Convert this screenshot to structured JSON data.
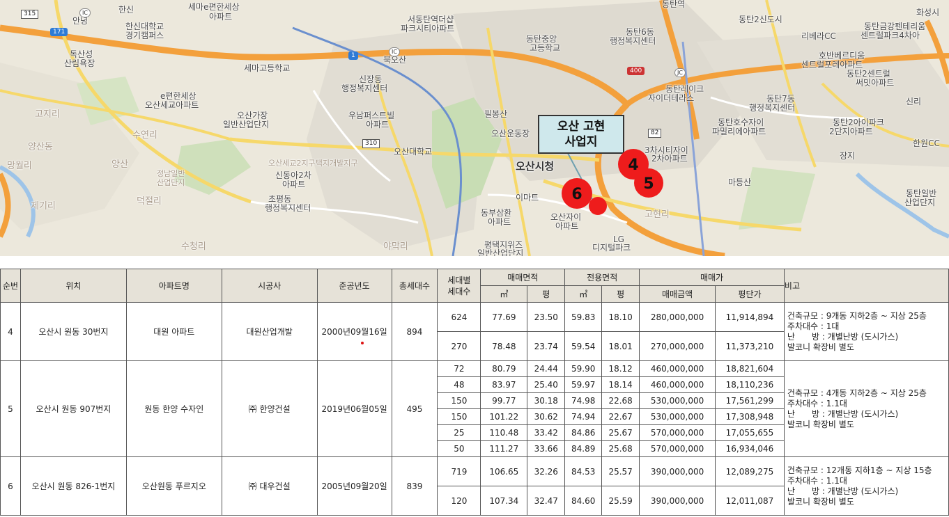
{
  "map": {
    "callout": {
      "line1": "오산 고현",
      "line2": "사업지"
    },
    "pins": [
      "4",
      "5",
      "6"
    ],
    "route_labels": [
      "315",
      "171",
      "1",
      "400",
      "310",
      "82"
    ],
    "labels": [
      "한신",
      "안녕",
      "세마e편한세상",
      "아파트",
      "한신대학교",
      "경기캠퍼스",
      "독산성",
      "산림욕장",
      "북오산",
      "세마고등학교",
      "신장동",
      "행정복지센터",
      "e편한세상",
      "오산세교아파트",
      "고지리",
      "수연리",
      "망월리",
      "양산동",
      "제기리",
      "덕절리",
      "수청리",
      "양산",
      "서동탄역더샵",
      "파크시티아파트",
      "동탄중앙",
      "고등학교",
      "동탄6동",
      "행정복지센터",
      "동탄역",
      "동탄2신도시",
      "리베라CC",
      "호반베르디움",
      "센트럴포레아파트",
      "동탄금강펜테리움",
      "센트럴파크4차아",
      "동탄2센트럴",
      "써밋아파트",
      "동탄레이크",
      "자이더테라스",
      "동탄7동",
      "행정복지센터",
      "동탄호수자이",
      "파밀리에아파트",
      "동탄2아이파크",
      "2단지아파트",
      "한원CC",
      "신리",
      "화성시",
      "오산가장",
      "일반산업단지",
      "우남퍼스트빌",
      "아파트",
      "필봉산",
      "오산대학교",
      "오산운동장",
      "오산세교2지구택지개발지구",
      "오산시청",
      "신동아2차",
      "아파트",
      "초평동",
      "행정복지센터",
      "이마트",
      "동부삼환",
      "아파트",
      "오산자이",
      "아파트",
      "정남일반",
      "산업단지",
      "3차시티자이",
      "2차아파트",
      "마등산",
      "고현리",
      "동탄일반",
      "산업단지",
      "장지",
      "야막리",
      "평택지위즈",
      "일반산업단지",
      "LG",
      "디지털파크"
    ]
  },
  "table": {
    "headers": {
      "seq": "순번",
      "location": "위치",
      "apt": "아파트명",
      "builder": "시공사",
      "completed": "준공년도",
      "households": "총세대수",
      "unit_households_1": "세대별",
      "unit_households_2": "세대수",
      "sale_area": "매매면적",
      "exclusive_area": "전용면적",
      "sale_price": "매매가",
      "note": "비고",
      "sqm": "㎡",
      "pyeong": "평",
      "sale_amount": "매매금액",
      "per_pyeong": "평단가"
    },
    "rows": [
      {
        "seq": "4",
        "location": "오산시 원동 30번지",
        "apt": "대원 아파트",
        "builder": "대원산업개발",
        "completed": "2000년09월16일",
        "households": "894",
        "units": [
          {
            "hh": "624",
            "sale_sqm": "77.69",
            "sale_py": "23.50",
            "ex_sqm": "59.83",
            "ex_py": "18.10",
            "price": "280,000,000",
            "per_py": "11,914,894"
          },
          {
            "hh": "270",
            "sale_sqm": "78.48",
            "sale_py": "23.74",
            "ex_sqm": "59.54",
            "ex_py": "18.01",
            "price": "270,000,000",
            "per_py": "11,373,210"
          }
        ],
        "note": [
          "건축규모 : 9개동 지하2층 ~ 지상 25층",
          "주차대수 : 1대",
          "난　　방 : 개별난방 (도시가스)",
          "발코니 확장비 별도"
        ]
      },
      {
        "seq": "5",
        "location": "오산시 원동 907번지",
        "apt": "원동 한양 수자인",
        "builder": "㈜ 한양건설",
        "completed": "2019년06월05일",
        "households": "495",
        "units": [
          {
            "hh": "72",
            "sale_sqm": "80.79",
            "sale_py": "24.44",
            "ex_sqm": "59.90",
            "ex_py": "18.12",
            "price": "460,000,000",
            "per_py": "18,821,604"
          },
          {
            "hh": "48",
            "sale_sqm": "83.97",
            "sale_py": "25.40",
            "ex_sqm": "59.97",
            "ex_py": "18.14",
            "price": "460,000,000",
            "per_py": "18,110,236"
          },
          {
            "hh": "150",
            "sale_sqm": "99.77",
            "sale_py": "30.18",
            "ex_sqm": "74.98",
            "ex_py": "22.68",
            "price": "530,000,000",
            "per_py": "17,561,299"
          },
          {
            "hh": "150",
            "sale_sqm": "101.22",
            "sale_py": "30.62",
            "ex_sqm": "74.94",
            "ex_py": "22.67",
            "price": "530,000,000",
            "per_py": "17,308,948"
          },
          {
            "hh": "25",
            "sale_sqm": "110.48",
            "sale_py": "33.42",
            "ex_sqm": "84.86",
            "ex_py": "25.67",
            "price": "570,000,000",
            "per_py": "17,055,655"
          },
          {
            "hh": "50",
            "sale_sqm": "111.27",
            "sale_py": "33.66",
            "ex_sqm": "84.89",
            "ex_py": "25.68",
            "price": "570,000,000",
            "per_py": "16,934,046"
          }
        ],
        "note": [
          "건축규모 : 4개동 지하2층 ~ 지상 25층",
          "주차대수 : 1.1대",
          "난　　방 : 개별난방 (도시가스)",
          "발코니 확장비 별도"
        ]
      },
      {
        "seq": "6",
        "location": "오산시 원동 826-1번지",
        "apt": "오산원동 푸르지오",
        "builder": "㈜ 대우건설",
        "completed": "2005년09월20일",
        "households": "839",
        "units": [
          {
            "hh": "719",
            "sale_sqm": "106.65",
            "sale_py": "32.26",
            "ex_sqm": "84.53",
            "ex_py": "25.57",
            "price": "390,000,000",
            "per_py": "12,089,275"
          },
          {
            "hh": "120",
            "sale_sqm": "107.34",
            "sale_py": "32.47",
            "ex_sqm": "84.60",
            "ex_py": "25.59",
            "price": "390,000,000",
            "per_py": "12,011,087"
          }
        ],
        "note": [
          "건축규모 : 12개동 지하1층 ~ 지상 15층",
          "주차대수 : 1.1대",
          "난　　방 : 개별난방 (도시가스)",
          "발코니 확장비 별도"
        ]
      }
    ]
  }
}
